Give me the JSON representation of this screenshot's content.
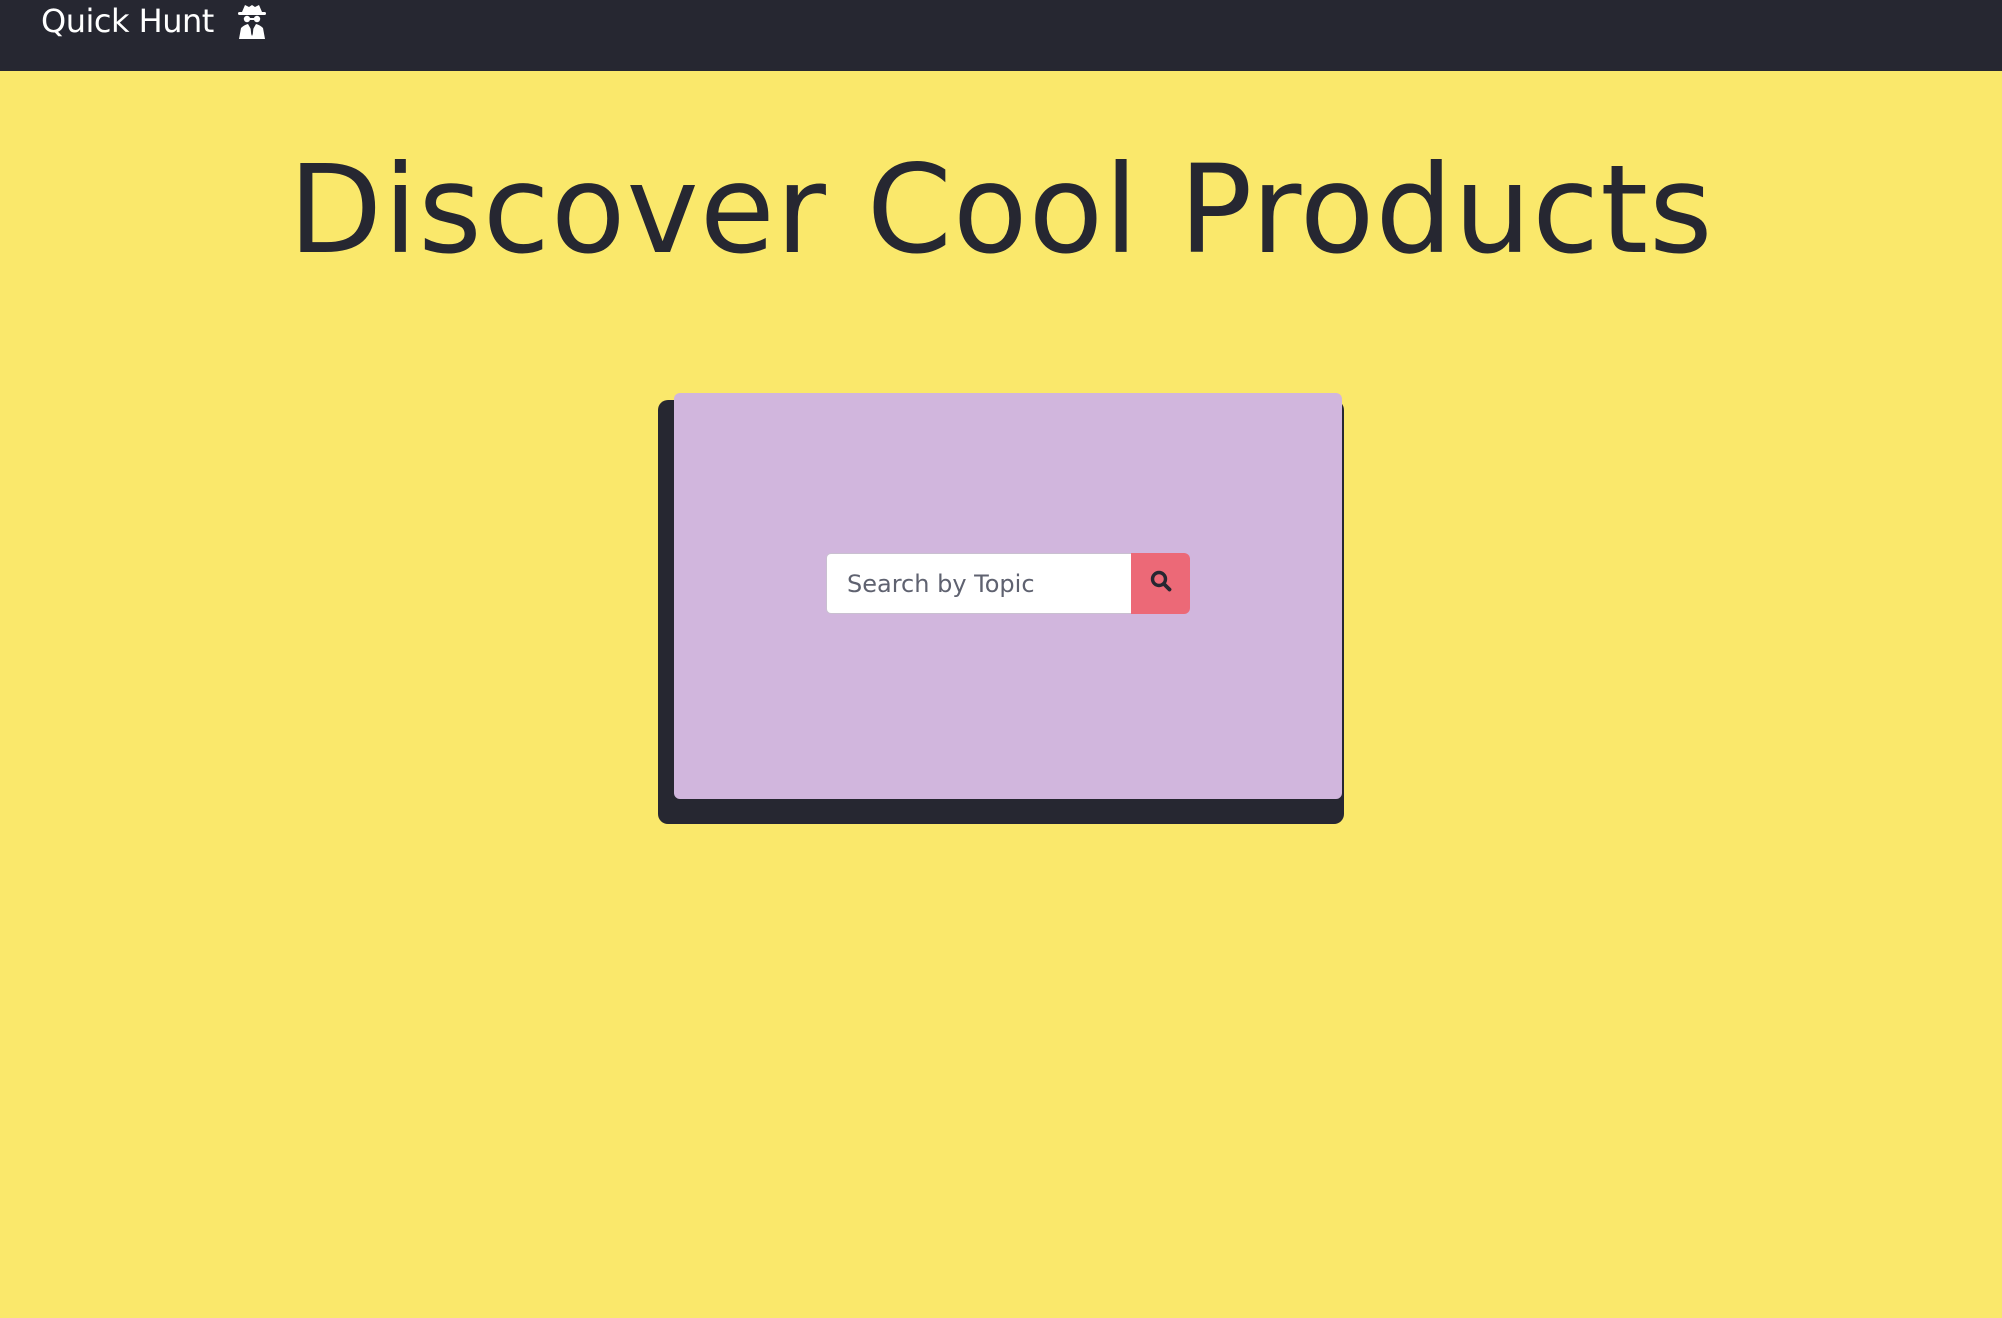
{
  "navbar": {
    "brand_label": "Quick Hunt",
    "brand_icon": "spy-icon",
    "background": "#262731"
  },
  "hero": {
    "title": "Discover Cool Products"
  },
  "search": {
    "placeholder": "Search by Topic",
    "value": "",
    "button_icon": "search-icon"
  },
  "colors": {
    "page_background": "#fae86b",
    "card_background": "#d1b6dd",
    "card_shadow": "#262731",
    "button_background": "#ec6977",
    "text_dark": "#262731"
  }
}
